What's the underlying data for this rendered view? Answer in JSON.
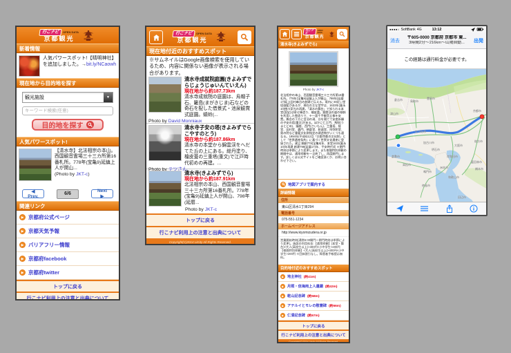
{
  "logo": {
    "badge": "行こナビ",
    "open_data": "OPEN DATA",
    "title": "京都観光"
  },
  "footer_common": {
    "back_to_top": "トップに戻る",
    "notes_link": "行こナビ利用上の注意と出典について",
    "copyright": "Copyright(C)2014 Litcity All Rights Reserved."
  },
  "screen1": {
    "section_news": "新着情報",
    "news": {
      "text": "人気パワースポット!【晴明神社】を追加しました。→",
      "link": "bit.ly/NCaowh"
    },
    "section_search": "現在地から目的地を探す",
    "search": {
      "dropdown_value": "観光施設",
      "dropdown_caret": "▼",
      "keyword_placeholder": "キーワード検索(任意)",
      "button_label": "目的地を探す"
    },
    "section_power": "人気パワースポット!",
    "power": {
      "text": "【清水寺】北法相宗の本山。西国観音霊場三十三カ所第16番札所。778年(宝亀9)延鎮上人が開山...",
      "photo_prefix": "(Photo by ",
      "photo_link": "JKT-c",
      "photo_suffix": ")"
    },
    "pagination": {
      "prev": "◀ Prev.",
      "page": "6/6",
      "next": "Next ▶"
    },
    "section_links": "関連リンク",
    "links": [
      {
        "label": "京都府公式ページ"
      },
      {
        "label": "京都天気予報"
      },
      {
        "label": "バリアフリー情報"
      },
      {
        "label": "京都府facebook"
      },
      {
        "label": "京都府twitter"
      }
    ]
  },
  "screen2": {
    "section_title": "現在地付近のおすすめスポット",
    "notice": "※サムネイルはGoogle画像検索を使用しているため、内容に関係ない画像が表示される場合があります。",
    "photo_by_label": "Photo by ",
    "spots": [
      {
        "title": "清水寺成就院庭園(きよみずでらじょうじゅいんていえん)",
        "distance": "現在地から約187.73km",
        "desc": "清水寺成就院の庭園は、烏帽子石、籬島(まがきじま)石などの奇石を配した借景式・池泉観賞式庭園。蜻蛉(...",
        "credit": "David Monniaux"
      },
      {
        "title": "清水寺子安の塔(きよみずでらこやすのとう)",
        "distance": "現在地から約187.86km",
        "desc": "清水寺の本堂から錦雲渓をへだてた丘の上にある。総丹塗り、檜皮葺の三重塔(重文)で江戸時代初めの再建。...",
        "credit": "テツさん"
      },
      {
        "title": "清水寺(きよみずでら)",
        "distance": "現在地から約187.91km",
        "desc": "北法相宗の本山、西国観音霊場三十三カ所第16番札所。778年(宝亀9)延鎮上人が開山、798年(延暦...",
        "credit": "JKT-c"
      }
    ]
  },
  "screen3": {
    "spot_title": "清水寺(きよみずでら)",
    "photo_by_label": "Photo by ",
    "photo_credit": "JKT-c",
    "description": "北法相宗の本山、西国観音霊場三十三カ所第16番札所。778年(宝亀9)延鎮上人が開山、798年(延暦17)坂上田村麻呂の創建と伝える。境内に30近い堂塔伽藍があるが、現在の主な堂宇は、1633年(寛永10)徳川家光の再建。「清水の舞台」で知られる本堂(国宝)は寄せ棟造り、檜皮葺。錦雲渓の崖の傾斜を利用した懸造りで、十一面千手観音立像を安置。舞台の下方に音羽の滝、谷を隔てて安産祈願の子安の塔(重文)がある。ほかに仁王門、馬駐(うまとどめ)、鐘楼、西門(さいもん)、三重塔、経堂、田村堂、轟門、朝倉堂、釈迦堂、阿弥陀堂、奥の院など重要文化財指定の建造物がいくつも連なる。1994年(平成6)12月「古都京都の文化財」として「世界遺産条約」に基づく世界文化遺産に登録された。建立:開創778(宝亀9)年、本堂1633(寛永10)年再建 創建798(延暦17)年、平安時代初 ※閉門時刻は季節により変更します。また夜間特別拝観の期間中は、通常拝観を一旦終了し、再度開門します。詳しくは公式サイトをご確認頂くか、お問い合わせ下さい。",
    "map_link": "地図アプリで案内する",
    "detail_header": "詳細情報",
    "details": [
      {
        "label": "住所",
        "value": "東山区清水1丁目294"
      },
      {
        "label": "電話番号",
        "value": "075-551-1234"
      },
      {
        "label": "ホームページアドレス",
        "value": "http://www.kiyomizudera.or.jp"
      }
    ],
    "hours_note": "営業開始時刻(通常6:00開門〜閉門時刻は季節により変更)。施設の利用料金:【通常拝観】(本堂・舞台)<大人(高校生以上)>300円<小中学生>200円 【夜間特別拝観】<大人(高校生以上)>400円<小中学生>200円 ※団体割引なし。障害者手帳提示無料。",
    "nearby_header": "目的地付近のおすすめスポット",
    "nearby": [
      {
        "name": "地主神社",
        "distance": "(約41m)"
      },
      {
        "name": "月照・信海両上人遺蹟",
        "distance": "(約42m)"
      },
      {
        "name": "乾山記念碑",
        "distance": "(約58m)"
      },
      {
        "name": "アテルイとモレの慰霊碑",
        "distance": "(約66m)"
      },
      {
        "name": "仁清記念碑",
        "distance": "(約67m)"
      }
    ]
  },
  "screen4": {
    "statusbar": {
      "signal": "●●●●○",
      "carrier": "SoftBank",
      "network": "4G",
      "time": "13:12"
    },
    "nav": {
      "clear": "消去",
      "dest_line1": "〒605-0000 京都府 京都市 東...",
      "dest_line2": "3時間2分〜216km〜山陽自動...",
      "depart": "出発"
    },
    "toll_banner": "この経路は通行料金が必要です。",
    "map_labels": [
      "倉吉市",
      "鳥取市",
      "豊岡市",
      "津山市",
      "京都市",
      "枚方市",
      "たつの市",
      "加古川市",
      "明石市",
      "大阪市",
      "岸和田市",
      "倉敷市",
      "高松市",
      "鳴門市",
      "徳島市",
      "洲本市",
      "和歌山市",
      "富田林市",
      "橋本市",
      "田辺市"
    ],
    "colors": {
      "route": "#2e6fe0",
      "water": "#aed1ee",
      "land": "#f2efe9",
      "highway": "#7cc47e",
      "ios_blue": "#157efc",
      "start_pin": "#35c759",
      "end_pin": "#ff3b30"
    }
  }
}
